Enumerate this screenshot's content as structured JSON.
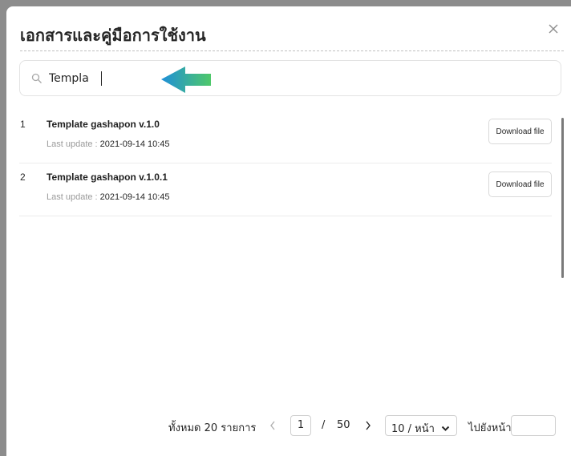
{
  "modal": {
    "title": "เอกสารและคู่มือการใช้งาน"
  },
  "search": {
    "value": "Templa",
    "icon": "search-icon"
  },
  "documents": [
    {
      "index": "1",
      "name": "Template gashapon v.1.0",
      "meta_label": "Last update :",
      "date": "2021-09-14 10:45",
      "button_label": "Download file"
    },
    {
      "index": "2",
      "name": "Template gashapon v.1.0.1",
      "meta_label": "Last update :",
      "date": "2021-09-14 10:45",
      "button_label": "Download file"
    }
  ],
  "pagination": {
    "total_label": "ทั้งหมด  20  รายการ",
    "current_page": "1",
    "separator": "/",
    "total_pages": "50",
    "page_size_label": "10 / หน้า",
    "goto_label": "ไปยังหน้า"
  },
  "colors": {
    "arrow_start": "#1e8fd8",
    "arrow_end": "#4fc86a"
  }
}
